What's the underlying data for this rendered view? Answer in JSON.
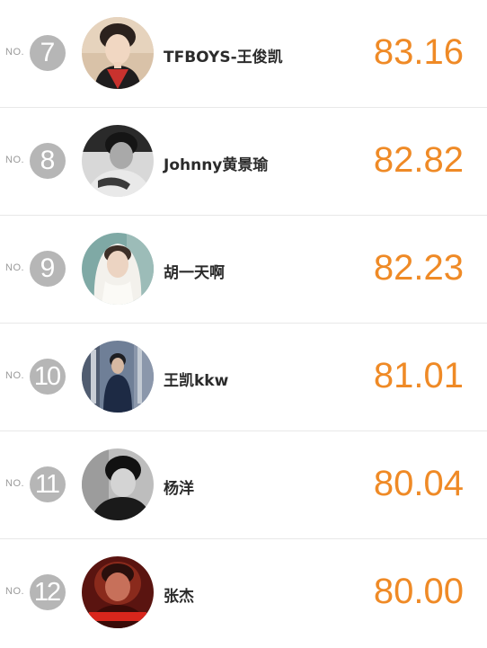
{
  "ranking": {
    "no_prefix": "NO.",
    "accent_color": "#ef8a26",
    "badge_color": "#b6b6b6",
    "items": [
      {
        "rank": "7",
        "name": "TFBOYS-王俊凯",
        "score": "83.16",
        "avatar": "portrait-photo"
      },
      {
        "rank": "8",
        "name": "Johnny黄景瑜",
        "score": "82.82",
        "avatar": "portrait-photo"
      },
      {
        "rank": "9",
        "name": "胡一天啊",
        "score": "82.23",
        "avatar": "portrait-photo"
      },
      {
        "rank": "10",
        "name": "王凯kkw",
        "score": "81.01",
        "avatar": "portrait-photo"
      },
      {
        "rank": "11",
        "name": "杨洋",
        "score": "80.04",
        "avatar": "portrait-photo"
      },
      {
        "rank": "12",
        "name": "张杰",
        "score": "80.00",
        "avatar": "portrait-photo"
      }
    ]
  }
}
